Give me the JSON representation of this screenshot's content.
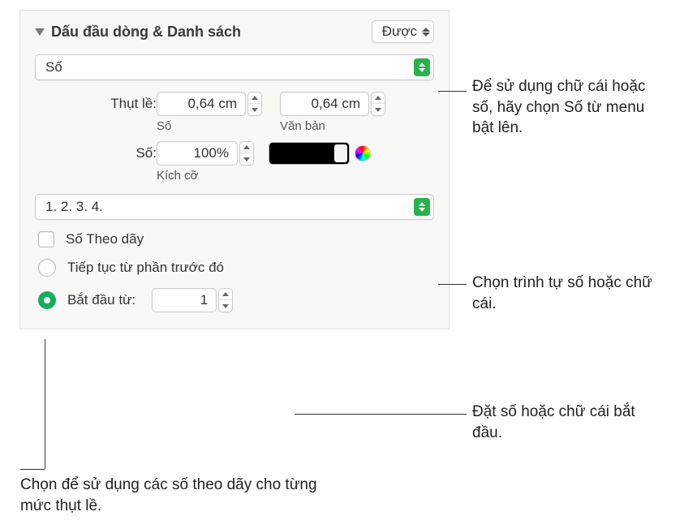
{
  "header": {
    "title": "Dấu đầu dòng & Danh sách",
    "style_label": "Được"
  },
  "type_select": "Số",
  "indent": {
    "label": "Thụt lề:",
    "number_value": "0,64 cm",
    "number_sublabel": "Số",
    "text_value": "0,64 cm",
    "text_sublabel": "Văn bản"
  },
  "size": {
    "label": "Số:",
    "value": "100%",
    "sublabel": "Kích cỡ"
  },
  "format_select": "1. 2. 3. 4.",
  "tiered_checkbox": "Số Theo dãy",
  "continue_radio": "Tiếp tục từ phần trước đó",
  "start_radio": "Bắt đầu từ:",
  "start_value": "1",
  "callouts": {
    "type": "Để sử dụng chữ cái hoặc số, hãy chọn Số từ menu bật lên.",
    "format": "Chọn trình tự số hoặc chữ cái.",
    "start": "Đặt số hoặc chữ cái bắt đầu.",
    "tiered": "Chọn để sử dụng các số theo dãy cho từng mức thụt lề."
  }
}
